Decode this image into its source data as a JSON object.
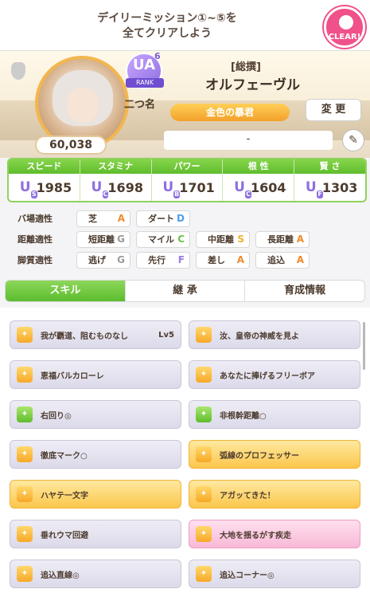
{
  "mission": {
    "text_line1": "デイリーミッション①~⑤を",
    "text_line2": "全てクリアしよう",
    "badge": "CLEAR!"
  },
  "profile": {
    "fans": "60,038",
    "rank": {
      "letters": "UA",
      "number": "6",
      "label": "RANK"
    },
    "epithet": "二つ名",
    "title_tag": "[総撰]",
    "name": "オルフェーヴル",
    "special_title": "金色の暴君",
    "change_label": "変 更",
    "comment": "-"
  },
  "stats": [
    {
      "label": "スピード",
      "grade": "U",
      "sub": "S",
      "value": "1985"
    },
    {
      "label": "スタミナ",
      "grade": "U",
      "sub": "C",
      "value": "1698"
    },
    {
      "label": "パワー",
      "grade": "U",
      "sub": "B",
      "value": "1701"
    },
    {
      "label": "根 性",
      "grade": "U",
      "sub": "C",
      "value": "1604"
    },
    {
      "label": "賢 さ",
      "grade": "U",
      "sub": "F",
      "value": "1303"
    }
  ],
  "aptitude": {
    "track": {
      "label": "バ場適性",
      "items": [
        {
          "name": "芝",
          "grade": "A"
        },
        {
          "name": "ダート",
          "grade": "D"
        }
      ]
    },
    "distance": {
      "label": "距離適性",
      "items": [
        {
          "name": "短距離",
          "grade": "G"
        },
        {
          "name": "マイル",
          "grade": "C"
        },
        {
          "name": "中距離",
          "grade": "S"
        },
        {
          "name": "長距離",
          "grade": "A"
        }
      ]
    },
    "style": {
      "label": "脚質適性",
      "items": [
        {
          "name": "逃げ",
          "grade": "G"
        },
        {
          "name": "先行",
          "grade": "F"
        },
        {
          "name": "差し",
          "grade": "A"
        },
        {
          "name": "追込",
          "grade": "A"
        }
      ]
    }
  },
  "tabs": [
    "スキル",
    "継 承",
    "育成情報"
  ],
  "skills": [
    {
      "name": "我が覇道、阻むものなし",
      "lv": "Lv5"
    },
    {
      "name": "汝、皇帝の神威を見よ"
    },
    {
      "name": "恵福バルカローレ"
    },
    {
      "name": "あなたに捧げるフリーボア"
    },
    {
      "name": "右回り◎"
    },
    {
      "name": "非根幹距離○"
    },
    {
      "name": "徹底マーク○"
    },
    {
      "name": "弧線のプロフェッサー"
    },
    {
      "name": "ハヤテ一文字"
    },
    {
      "name": "アガッてきた！"
    },
    {
      "name": "垂れウマ回避"
    },
    {
      "name": "大地を揺るがす疾走"
    },
    {
      "name": "追込直線◎"
    },
    {
      "name": "追込コーナー◎"
    }
  ],
  "colors": {
    "grade_A": "#f08a2e",
    "grade_S": "#f2b12c",
    "grade_B": "#e26b9a",
    "grade_C": "#6cc04a",
    "grade_D": "#4f9fe8",
    "grade_F": "#9a7be0",
    "grade_G": "#9a9a9a",
    "accent_green": "#6bc43a"
  },
  "icons": {
    "carrot": "carrot-icon",
    "edit": "pencil-icon",
    "skill": "skill-icon"
  }
}
